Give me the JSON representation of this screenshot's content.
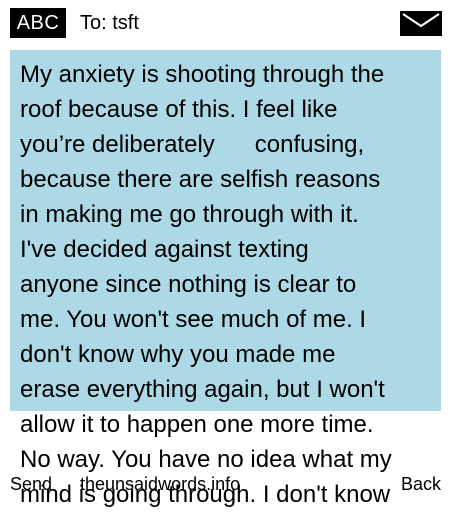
{
  "header": {
    "input_mode": "ABC",
    "recipient": "To: tsft",
    "mail_icon": "envelope-icon"
  },
  "colors": {
    "message_background": "#add8e6",
    "header_badge": "#000000"
  },
  "message": {
    "text": "My anxiety is shooting through the\nroof because of this. I feel like\nyou’re deliberately      confusing,\nbecause there are selfish reasons\nin making me go through with it.\nI've decided against texting\nanyone since nothing is clear to\nme. You won't see much of me. I\ndon't know why you made me\nerase everything again, but I won't\nallow it to happen one more time.\nNo way. You have no idea what my\nmind is going through. I don't know"
  },
  "softkeys": {
    "left": "Send",
    "center": "theunsaidwords.info",
    "right": "Back"
  }
}
